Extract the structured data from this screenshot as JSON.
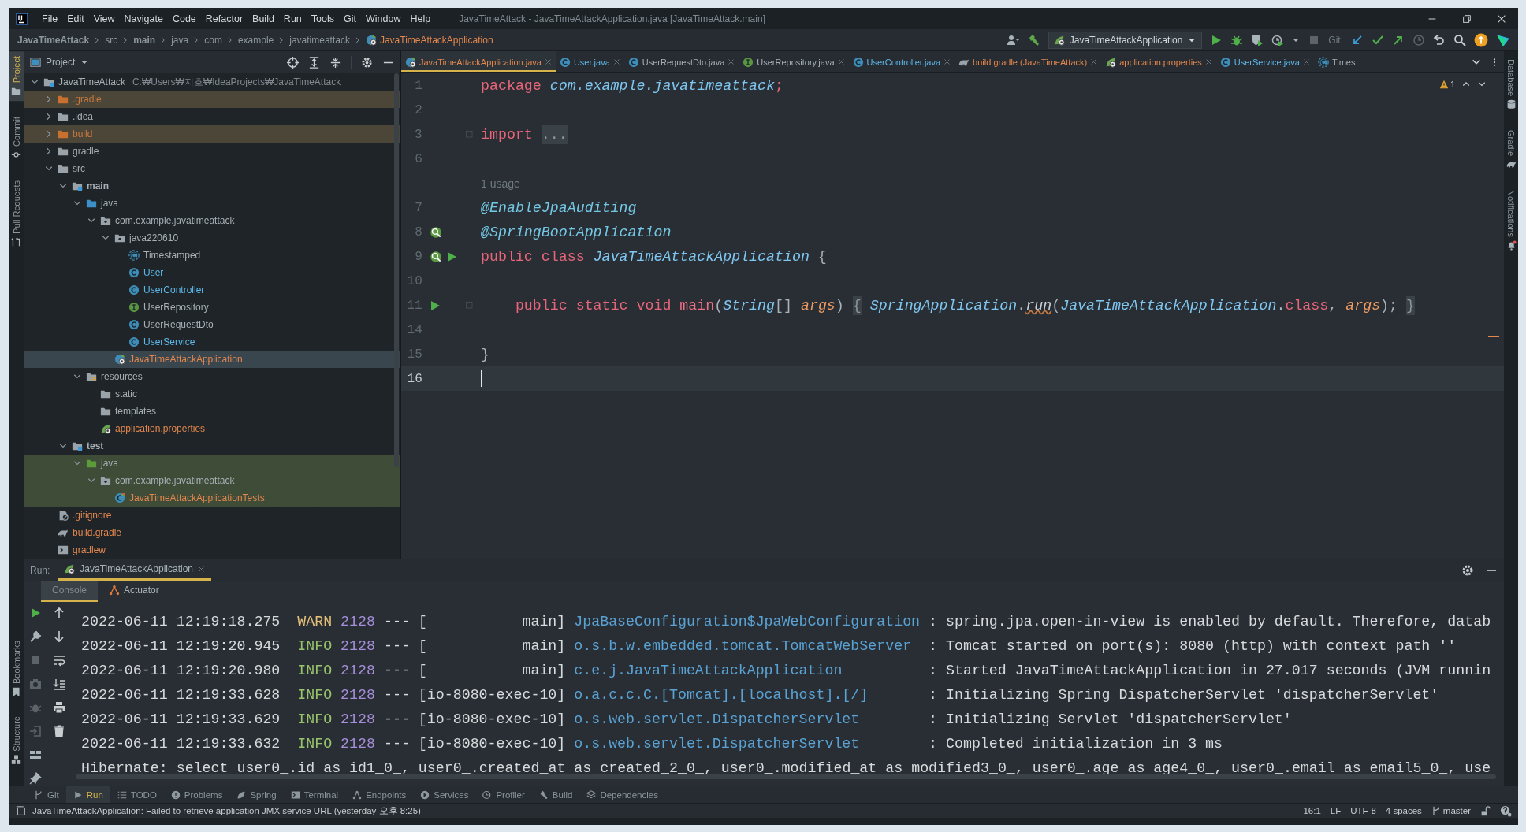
{
  "window": {
    "title": "JavaTimeAttack - JavaTimeAttackApplication.java [JavaTimeAttack.main]"
  },
  "menu": [
    "File",
    "Edit",
    "View",
    "Navigate",
    "Code",
    "Refactor",
    "Build",
    "Run",
    "Tools",
    "Git",
    "Window",
    "Help"
  ],
  "breadcrumbs": [
    {
      "label": "JavaTimeAttack",
      "kind": "project"
    },
    {
      "label": "src",
      "kind": "dir"
    },
    {
      "label": "main",
      "kind": "project"
    },
    {
      "label": "java",
      "kind": "dir"
    },
    {
      "label": "com",
      "kind": "dir"
    },
    {
      "label": "example",
      "kind": "dir"
    },
    {
      "label": "javatimeattack",
      "kind": "dir"
    },
    {
      "label": "JavaTimeAttackApplication",
      "kind": "file"
    }
  ],
  "toolbar": {
    "run_config": "JavaTimeAttackApplication",
    "git_label": "Git:"
  },
  "left_strip": {
    "top": [
      {
        "label": "Project",
        "kind": "folder",
        "selected": true
      },
      {
        "label": "Commit",
        "kind": "commit",
        "selected": false
      },
      {
        "label": "Pull Requests",
        "kind": "pull",
        "selected": false
      }
    ],
    "bottom": [
      {
        "label": "Bookmarks",
        "kind": "bookmark",
        "selected": false
      },
      {
        "label": "Structure",
        "kind": "structure",
        "selected": false
      }
    ]
  },
  "right_strip": [
    {
      "label": "Database",
      "kind": "database"
    },
    {
      "label": "Gradle",
      "kind": "gradle"
    },
    {
      "label": "Notifications",
      "kind": "bell"
    }
  ],
  "project": {
    "title": "Project",
    "tree": [
      {
        "label": "JavaTimeAttack",
        "note": "C:₩Users₩지호₩IdeaProjects₩JavaTimeAttack",
        "kind": "module",
        "color": "#a7b0b6",
        "test": false,
        "expanded": true,
        "selected": false,
        "children": [
          {
            "label": ".gradle",
            "kind": "excluded",
            "color": "#c9783e",
            "test": false,
            "expanded": false,
            "selected": false
          },
          {
            "label": ".idea",
            "kind": "folder",
            "color": "#a7b0b6",
            "test": false,
            "expanded": false,
            "selected": false
          },
          {
            "label": "build",
            "kind": "excluded",
            "color": "#c9783e",
            "test": false,
            "expanded": false,
            "selected": false
          },
          {
            "label": "gradle",
            "kind": "folder",
            "color": "#a7b0b6",
            "test": false,
            "expanded": false,
            "selected": false
          },
          {
            "label": "src",
            "kind": "folder",
            "color": "#a7b0b6",
            "test": false,
            "expanded": true,
            "selected": false,
            "children": [
              {
                "label": "main",
                "kind": "module",
                "color": "#a7b0b6",
                "test": false,
                "expanded": true,
                "selected": false,
                "children": [
                  {
                    "label": "java",
                    "kind": "source",
                    "color": "#a7b0b6",
                    "test": false,
                    "expanded": true,
                    "selected": false,
                    "children": [
                      {
                        "label": "com.example.javatimeattack",
                        "kind": "package",
                        "color": "#a7b0b6",
                        "test": false,
                        "expanded": true,
                        "selected": false,
                        "children": [
                          {
                            "label": "java220610",
                            "kind": "package",
                            "color": "#a7b0b6",
                            "test": false,
                            "expanded": true,
                            "selected": false,
                            "children": [
                              {
                                "label": "Timestamped",
                                "kind": "abstract",
                                "color": "#a7b0b6",
                                "test": false,
                                "selected": false
                              },
                              {
                                "label": "User",
                                "kind": "class",
                                "color": "#5db8ea",
                                "test": false,
                                "selected": false
                              },
                              {
                                "label": "UserController",
                                "kind": "class",
                                "color": "#5db8ea",
                                "test": false,
                                "selected": false
                              },
                              {
                                "label": "UserRepository",
                                "kind": "interface",
                                "color": "#a7b0b6",
                                "test": false,
                                "selected": false
                              },
                              {
                                "label": "UserRequestDto",
                                "kind": "class",
                                "color": "#a7b0b6",
                                "test": false,
                                "selected": false
                              },
                              {
                                "label": "UserService",
                                "kind": "class",
                                "color": "#5db8ea",
                                "test": false,
                                "selected": false
                              }
                            ]
                          },
                          {
                            "label": "JavaTimeAttackApplication",
                            "kind": "spring",
                            "color": "#e3874e",
                            "test": false,
                            "selected": true
                          }
                        ]
                      }
                    ]
                  },
                  {
                    "label": "resources",
                    "kind": "resources",
                    "color": "#a7b0b6",
                    "test": false,
                    "expanded": true,
                    "selected": false,
                    "children": [
                      {
                        "label": "static",
                        "kind": "folder",
                        "color": "#a7b0b6",
                        "test": false,
                        "selected": false
                      },
                      {
                        "label": "templates",
                        "kind": "folder",
                        "color": "#a7b0b6",
                        "test": false,
                        "selected": false
                      },
                      {
                        "label": "application.properties",
                        "kind": "properties",
                        "color": "#e3874e",
                        "test": false,
                        "selected": false
                      }
                    ]
                  }
                ]
              },
              {
                "label": "test",
                "kind": "module",
                "color": "#a7b0b6",
                "test": false,
                "expanded": true,
                "selected": false,
                "children": [
                  {
                    "label": "java",
                    "kind": "testroot",
                    "color": "#a7b0b6",
                    "test": true,
                    "expanded": true,
                    "selected": false,
                    "children": [
                      {
                        "label": "com.example.javatimeattack",
                        "kind": "package",
                        "color": "#a7b0b6",
                        "test": true,
                        "expanded": true,
                        "selected": false,
                        "children": [
                          {
                            "label": "JavaTimeAttackApplicationTests",
                            "kind": "testclass",
                            "color": "#e3874e",
                            "test": true,
                            "selected": false
                          }
                        ]
                      }
                    ]
                  }
                ]
              }
            ]
          },
          {
            "label": ".gitignore",
            "kind": "gitignore",
            "color": "#e3874e",
            "test": false,
            "selected": false
          },
          {
            "label": "build.gradle",
            "kind": "gradle",
            "color": "#e3874e",
            "test": false,
            "selected": false
          },
          {
            "label": "gradlew",
            "kind": "script",
            "color": "#e3874e",
            "test": false,
            "selected": false
          }
        ]
      }
    ]
  },
  "editor": {
    "tabs": [
      {
        "label": "JavaTimeAttackApplication.java",
        "kind": "spring",
        "color": "#e3874e",
        "selected": true
      },
      {
        "label": "User.java",
        "kind": "class",
        "color": "#5db8ea",
        "selected": false
      },
      {
        "label": "UserRequestDto.java",
        "kind": "class",
        "color": "#a7b0b6",
        "selected": false
      },
      {
        "label": "UserRepository.java",
        "kind": "interface",
        "color": "#a7b0b6",
        "selected": false
      },
      {
        "label": "UserController.java",
        "kind": "class",
        "color": "#5db8ea",
        "selected": false
      },
      {
        "label": "build.gradle (JavaTimeAttack)",
        "kind": "gradle",
        "color": "#e3874e",
        "selected": false
      },
      {
        "label": "application.properties",
        "kind": "properties",
        "color": "#e3874e",
        "selected": false
      },
      {
        "label": "UserService.java",
        "kind": "class",
        "color": "#5db8ea",
        "selected": false
      },
      {
        "label": "Times",
        "kind": "abstract",
        "color": "#a7b0b6",
        "selected": false
      }
    ],
    "warnings": "1",
    "lines": [
      {
        "number": "1",
        "current": false,
        "tokens": [
          {
            "kind": "keyword",
            "text": "package "
          },
          {
            "kind": "package",
            "text": "com.example.javatimeattack"
          },
          {
            "kind": "keyword",
            "text": ";"
          }
        ]
      },
      {
        "number": "2",
        "current": false
      },
      {
        "number": "3",
        "current": false,
        "tokens": [
          {
            "kind": "keyword",
            "text": "import "
          },
          {
            "kind": "fold",
            "text": "..."
          }
        ]
      },
      {
        "number": "6",
        "current": false
      },
      {
        "hint": "1 usage",
        "current": false
      },
      {
        "number": "7",
        "current": false,
        "tokens": [
          {
            "kind": "annotation",
            "text": "@EnableJpaAuditing"
          }
        ]
      },
      {
        "number": "8",
        "current": false,
        "gutter": [
          {
            "kind": "bean"
          }
        ],
        "tokens": [
          {
            "kind": "annotation",
            "text": "@SpringBootApplication"
          }
        ]
      },
      {
        "number": "9",
        "current": false,
        "gutter": [
          {
            "kind": "bean"
          },
          {
            "kind": "run"
          }
        ],
        "tokens": [
          {
            "kind": "keyword",
            "text": "public class "
          },
          {
            "kind": "type",
            "text": "JavaTimeAttackApplication"
          },
          {
            "kind": "punct",
            "text": " {"
          }
        ]
      },
      {
        "number": "10",
        "current": false
      },
      {
        "number": "11",
        "current": false,
        "gutter": [
          {
            "kind": "run"
          }
        ],
        "tokens": [
          {
            "kind": "keyword",
            "text": "    public static void "
          },
          {
            "kind": "method",
            "text": "main"
          },
          {
            "kind": "punct",
            "text": "("
          },
          {
            "kind": "type",
            "text": "String"
          },
          {
            "kind": "punct",
            "text": "[] "
          },
          {
            "kind": "param",
            "text": "args"
          },
          {
            "kind": "punct",
            "text": ") "
          },
          {
            "kind": "fold",
            "text": "{"
          },
          {
            "kind": "type",
            "text": " SpringApplication"
          },
          {
            "kind": "punct",
            "text": "."
          },
          {
            "kind": "call",
            "text": "run"
          },
          {
            "kind": "punct",
            "text": "("
          },
          {
            "kind": "type",
            "text": "JavaTimeAttackApplication"
          },
          {
            "kind": "punct",
            "text": "."
          },
          {
            "kind": "keyword",
            "text": "class"
          },
          {
            "kind": "punct",
            "text": ", "
          },
          {
            "kind": "param",
            "text": "args"
          },
          {
            "kind": "punct",
            "text": "); "
          },
          {
            "kind": "fold",
            "text": "}"
          }
        ]
      },
      {
        "number": "14",
        "current": false
      },
      {
        "number": "15",
        "current": false,
        "tokens": [
          {
            "kind": "punct",
            "text": "}"
          }
        ]
      },
      {
        "number": "16",
        "current": true
      }
    ]
  },
  "run": {
    "label": "Run:",
    "tab": {
      "label": "JavaTimeAttackApplication",
      "selected": true
    },
    "subtabs": [
      {
        "label": "Console",
        "selected": true
      },
      {
        "label": "Actuator",
        "selected": false
      }
    ],
    "console": [
      {
        "kind": "log",
        "timestamp": "2022-06-11 12:19:18.275",
        "level": "WARN",
        "color": "#e5c07b",
        "pid": "2128",
        "separator": "---",
        "thread": "[           main]",
        "logger": "JpaBaseConfiguration$JpaWebConfiguration",
        "message": ": spring.jpa.open-in-view is enabled by default. Therefore, datab"
      },
      {
        "kind": "log",
        "timestamp": "2022-06-11 12:19:20.945",
        "level": "INFO",
        "color": "#98c36d",
        "pid": "2128",
        "separator": "---",
        "thread": "[           main]",
        "logger": "o.s.b.w.embedded.tomcat.TomcatWebServer",
        "message": ": Tomcat started on port(s): 8080 (http) with context path ''"
      },
      {
        "kind": "log",
        "timestamp": "2022-06-11 12:19:20.980",
        "level": "INFO",
        "color": "#98c36d",
        "pid": "2128",
        "separator": "---",
        "thread": "[           main]",
        "logger": "c.e.j.JavaTimeAttackApplication",
        "message": ": Started JavaTimeAttackApplication in 27.017 seconds (JVM runnin"
      },
      {
        "kind": "log",
        "timestamp": "2022-06-11 12:19:33.628",
        "level": "INFO",
        "color": "#98c36d",
        "pid": "2128",
        "separator": "---",
        "thread": "[io-8080-exec-10]",
        "logger": "o.a.c.c.C.[Tomcat].[localhost].[/]",
        "message": ": Initializing Spring DispatcherServlet 'dispatcherServlet'"
      },
      {
        "kind": "log",
        "timestamp": "2022-06-11 12:19:33.629",
        "level": "INFO",
        "color": "#98c36d",
        "pid": "2128",
        "separator": "---",
        "thread": "[io-8080-exec-10]",
        "logger": "o.s.web.servlet.DispatcherServlet",
        "message": ": Initializing Servlet 'dispatcherServlet'"
      },
      {
        "kind": "log",
        "timestamp": "2022-06-11 12:19:33.632",
        "level": "INFO",
        "color": "#98c36d",
        "pid": "2128",
        "separator": "---",
        "thread": "[io-8080-exec-10]",
        "logger": "o.s.web.servlet.DispatcherServlet",
        "message": ": Completed initialization in 3 ms"
      },
      {
        "kind": "plain",
        "text": "Hibernate: select user0_.id as id1_0_, user0_.created_at as created_2_0_, user0_.modified_at as modified3_0_, user0_.age as age4_0_, user0_.email as email5_0_, use"
      }
    ]
  },
  "tool_windows": [
    {
      "label": "Git",
      "kind": "git",
      "selected": false
    },
    {
      "label": "Run",
      "kind": "run",
      "selected": true
    },
    {
      "label": "TODO",
      "kind": "list",
      "selected": false
    },
    {
      "label": "Problems",
      "kind": "problem",
      "selected": false
    },
    {
      "label": "Spring",
      "kind": "leaf",
      "selected": false
    },
    {
      "label": "Terminal",
      "kind": "terminal",
      "selected": false
    },
    {
      "label": "Endpoints",
      "kind": "endpoints",
      "selected": false
    },
    {
      "label": "Services",
      "kind": "services",
      "selected": false
    },
    {
      "label": "Profiler",
      "kind": "profiler",
      "selected": false
    },
    {
      "label": "Build",
      "kind": "hammer",
      "selected": false
    },
    {
      "label": "Dependencies",
      "kind": "deps",
      "selected": false
    }
  ],
  "status_bar": {
    "message": "JavaTimeAttackApplication: Failed to retrieve application JMX service URL (yesterday 오후 8:25)",
    "position": "16:1",
    "line_ending": "LF",
    "encoding": "UTF-8",
    "indent": "4 spaces",
    "branch": "master"
  }
}
